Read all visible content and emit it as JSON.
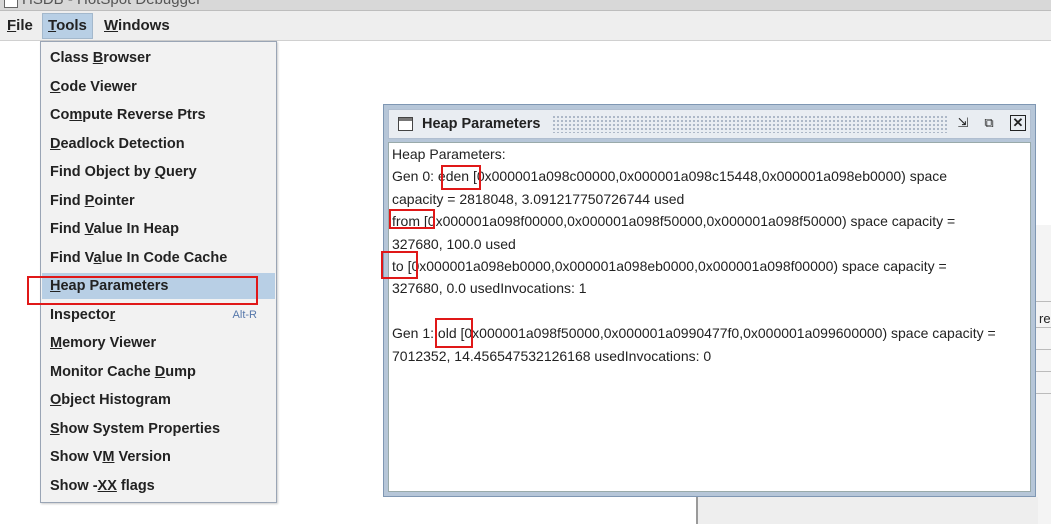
{
  "window": {
    "title": "HSDB - HotSpot Debugger"
  },
  "menubar": [
    {
      "id": "file",
      "label": "File",
      "underline": 0
    },
    {
      "id": "tools",
      "label": "Tools",
      "underline": 0
    },
    {
      "id": "windows",
      "label": "Windows",
      "underline": 0
    }
  ],
  "tools_menu": [
    {
      "label": "Class Browser",
      "mnemonic": "B"
    },
    {
      "label": "Code Viewer",
      "mnemonic": "C"
    },
    {
      "label": "Compute Reverse Ptrs",
      "mnemonic": "m"
    },
    {
      "label": "Deadlock Detection",
      "mnemonic": "D"
    },
    {
      "label": "Find Object by Query",
      "mnemonic": "Q"
    },
    {
      "label": "Find Pointer",
      "mnemonic": "P"
    },
    {
      "label": "Find Value In Heap",
      "mnemonic": "V"
    },
    {
      "label": "Find Value In Code Cache",
      "mnemonic": "a"
    },
    {
      "label": "Heap Parameters",
      "mnemonic": "H",
      "selected": true
    },
    {
      "label": "Inspector",
      "mnemonic": "r",
      "accelerator": "Alt-R"
    },
    {
      "label": "Memory Viewer",
      "mnemonic": "M"
    },
    {
      "label": "Monitor Cache Dump",
      "mnemonic": "D"
    },
    {
      "label": "Object Histogram",
      "mnemonic": "O"
    },
    {
      "label": "Show System Properties",
      "mnemonic": "S"
    },
    {
      "label": "Show VM Version",
      "mnemonic": "M"
    },
    {
      "label": "Show -XX flags",
      "mnemonic": "XX"
    }
  ],
  "heap_window": {
    "title": "Heap Parameters",
    "lines": [
      "Heap Parameters:",
      "Gen 0:  eden [0x000001a098c00000,0x000001a098c15448,0x000001a098eb0000) space",
      "capacity = 2818048, 3.091217750726744 used",
      "  from [0x000001a098f00000,0x000001a098f50000,0x000001a098f50000) space capacity =",
      "327680, 100.0 used",
      "  to   [0x000001a098eb0000,0x000001a098eb0000,0x000001a098f00000) space capacity =",
      "327680, 0.0 usedInvocations: 1",
      "",
      "Gen 1:  old  [0x000001a098f50000,0x000001a0990477f0,0x000001a099600000) space capacity =",
      "7012352, 14.456547532126168 usedInvocations: 0"
    ]
  },
  "right_panel": {
    "partial_text": "re"
  },
  "colors": {
    "highlight": "#e01818",
    "menu_selected": "#b8cfe5",
    "frame_border": "#b6c6d8"
  }
}
